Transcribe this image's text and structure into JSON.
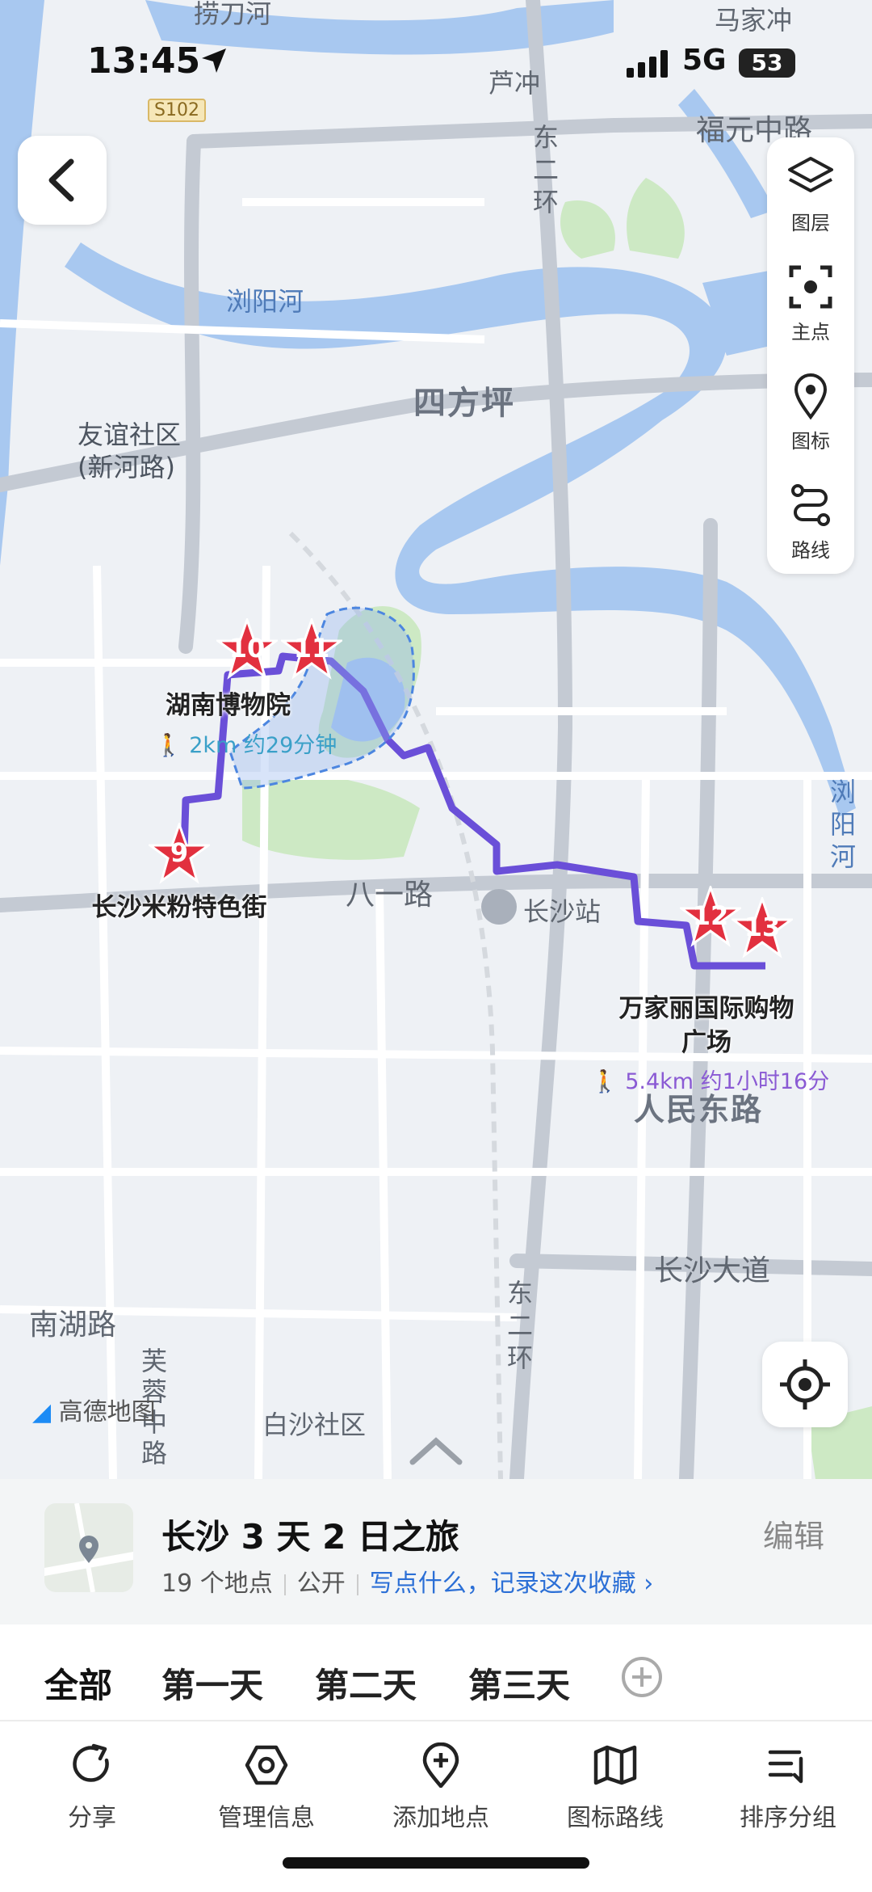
{
  "status_bar": {
    "time": "13:45",
    "network": "5G",
    "battery": "53"
  },
  "map": {
    "labels": {
      "lao_dao_he": "捞刀河",
      "ma_jia_chong": "马家冲",
      "lu_chong": "芦冲",
      "s102": "S102",
      "fu_yuan_zhong_lu": "福元中路",
      "dong_er_huan_top": "东二环",
      "liu_yang_he_top": "浏阳河",
      "si_fang_ping": "四方坪",
      "you_yi_community": "友谊社区(新河路)",
      "ba_yi_lu": "八一路",
      "changsha_station": "长沙站",
      "liu_yang_he_right": "浏阳河",
      "ren_min_dong_lu": "人民东路",
      "changsha_da_dao": "长沙大道",
      "nan_hu_lu": "南湖路",
      "fu_rong_zhong_lu": "芙蓉中路",
      "dong_er_huan_bottom": "东二环",
      "bai_sha_community": "白沙社区",
      "logo": "高德地图"
    },
    "markers": [
      {
        "num": "9",
        "name": "长沙米粉特色街"
      },
      {
        "num": "10",
        "name": "湖南博物院"
      },
      {
        "num": "11",
        "name": ""
      },
      {
        "num": "12",
        "name": "万家丽国际购物广场"
      },
      {
        "num": "13",
        "name": ""
      }
    ],
    "walk_segments": [
      {
        "text": "2km 约29分钟"
      },
      {
        "text": "5.4km 约1小时16分"
      }
    ],
    "route_color": "#6a4fd8",
    "marker_color": "#e2303f"
  },
  "toolbar": {
    "layers": "图层",
    "main_point": "主点",
    "icon": "图标",
    "route": "路线"
  },
  "trip": {
    "title": "长沙 3 天 2 日之旅",
    "edit": "编辑",
    "count": "19 个地点",
    "visibility": "公开",
    "note_link": "写点什么，记录这次收藏 ›"
  },
  "tabs": [
    "全部",
    "第一天",
    "第二天",
    "第三天"
  ],
  "actions": [
    "分享",
    "管理信息",
    "添加地点",
    "图标路线",
    "排序分组"
  ]
}
